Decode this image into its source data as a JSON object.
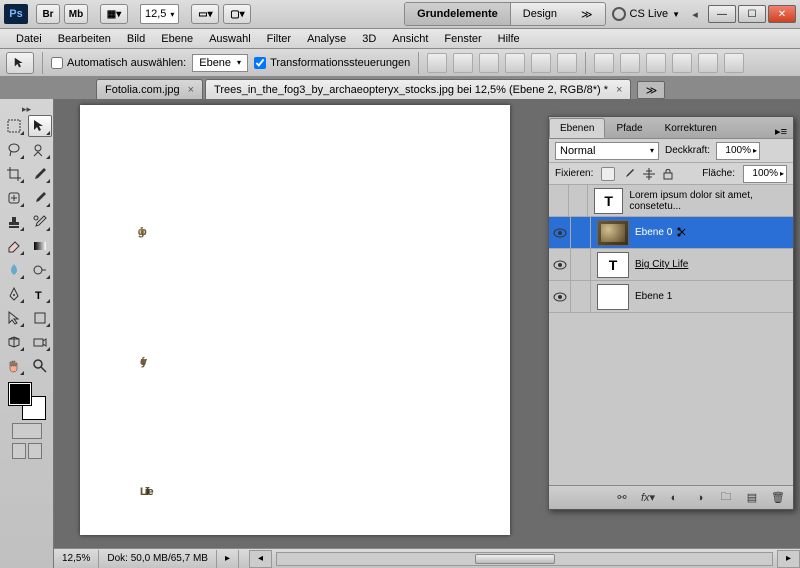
{
  "titlebar": {
    "zoom": "12,5",
    "workspaces": {
      "active": "Grundelemente",
      "other": "Design"
    },
    "cslive": "CS Live"
  },
  "menu": [
    "Datei",
    "Bearbeiten",
    "Bild",
    "Ebene",
    "Auswahl",
    "Filter",
    "Analyse",
    "3D",
    "Ansicht",
    "Fenster",
    "Hilfe"
  ],
  "options": {
    "auto_select_label": "Automatisch auswählen:",
    "auto_select_value": "Ebene",
    "transform_label": "Transformationssteuerungen"
  },
  "doctabs": {
    "inactive": "Fotolia.com.jpg",
    "active": "Trees_in_the_fog3_by_archaeopteryx_stocks.jpg bei 12,5% (Ebene 2, RGB/8*) *"
  },
  "panel": {
    "tabs": [
      "Ebenen",
      "Pfade",
      "Korrekturen"
    ],
    "blend_mode": "Normal",
    "opacity_label": "Deckkraft:",
    "opacity_value": "100%",
    "lock_label": "Fixieren:",
    "fill_label": "Fläche:",
    "fill_value": "100%",
    "layers": [
      {
        "visible": false,
        "type": "text",
        "name": "Lorem ipsum dolor sit amet, consetetu...",
        "selected": false
      },
      {
        "visible": true,
        "type": "image",
        "name": "Ebene 0",
        "selected": true
      },
      {
        "visible": true,
        "type": "text",
        "name": "Big City Life",
        "selected": false,
        "underline": true
      },
      {
        "visible": true,
        "type": "blank",
        "name": "Ebene 1",
        "selected": false
      }
    ]
  },
  "status": {
    "zoom": "12,5%",
    "doc": "Dok: 50,0 MB/65,7 MB"
  },
  "canvas": {
    "lines": [
      "big",
      "city",
      "Life"
    ]
  }
}
